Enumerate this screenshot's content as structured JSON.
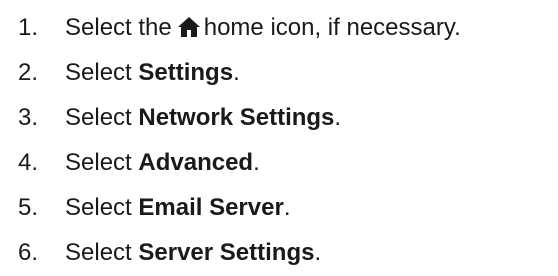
{
  "steps": [
    {
      "number": "1.",
      "prefix": "Select the",
      "icon": "home-icon",
      "suffix": "home icon, if necessary."
    },
    {
      "number": "2.",
      "prefix": "Select ",
      "bold": "Settings",
      "suffix": "."
    },
    {
      "number": "3.",
      "prefix": "Select ",
      "bold": "Network Settings",
      "suffix": "."
    },
    {
      "number": "4.",
      "prefix": "Select ",
      "bold": "Advanced",
      "suffix": "."
    },
    {
      "number": "5.",
      "prefix": "Select ",
      "bold": "Email Server",
      "suffix": "."
    },
    {
      "number": "6.",
      "prefix": "Select ",
      "bold": "Server Settings",
      "suffix": "."
    }
  ]
}
